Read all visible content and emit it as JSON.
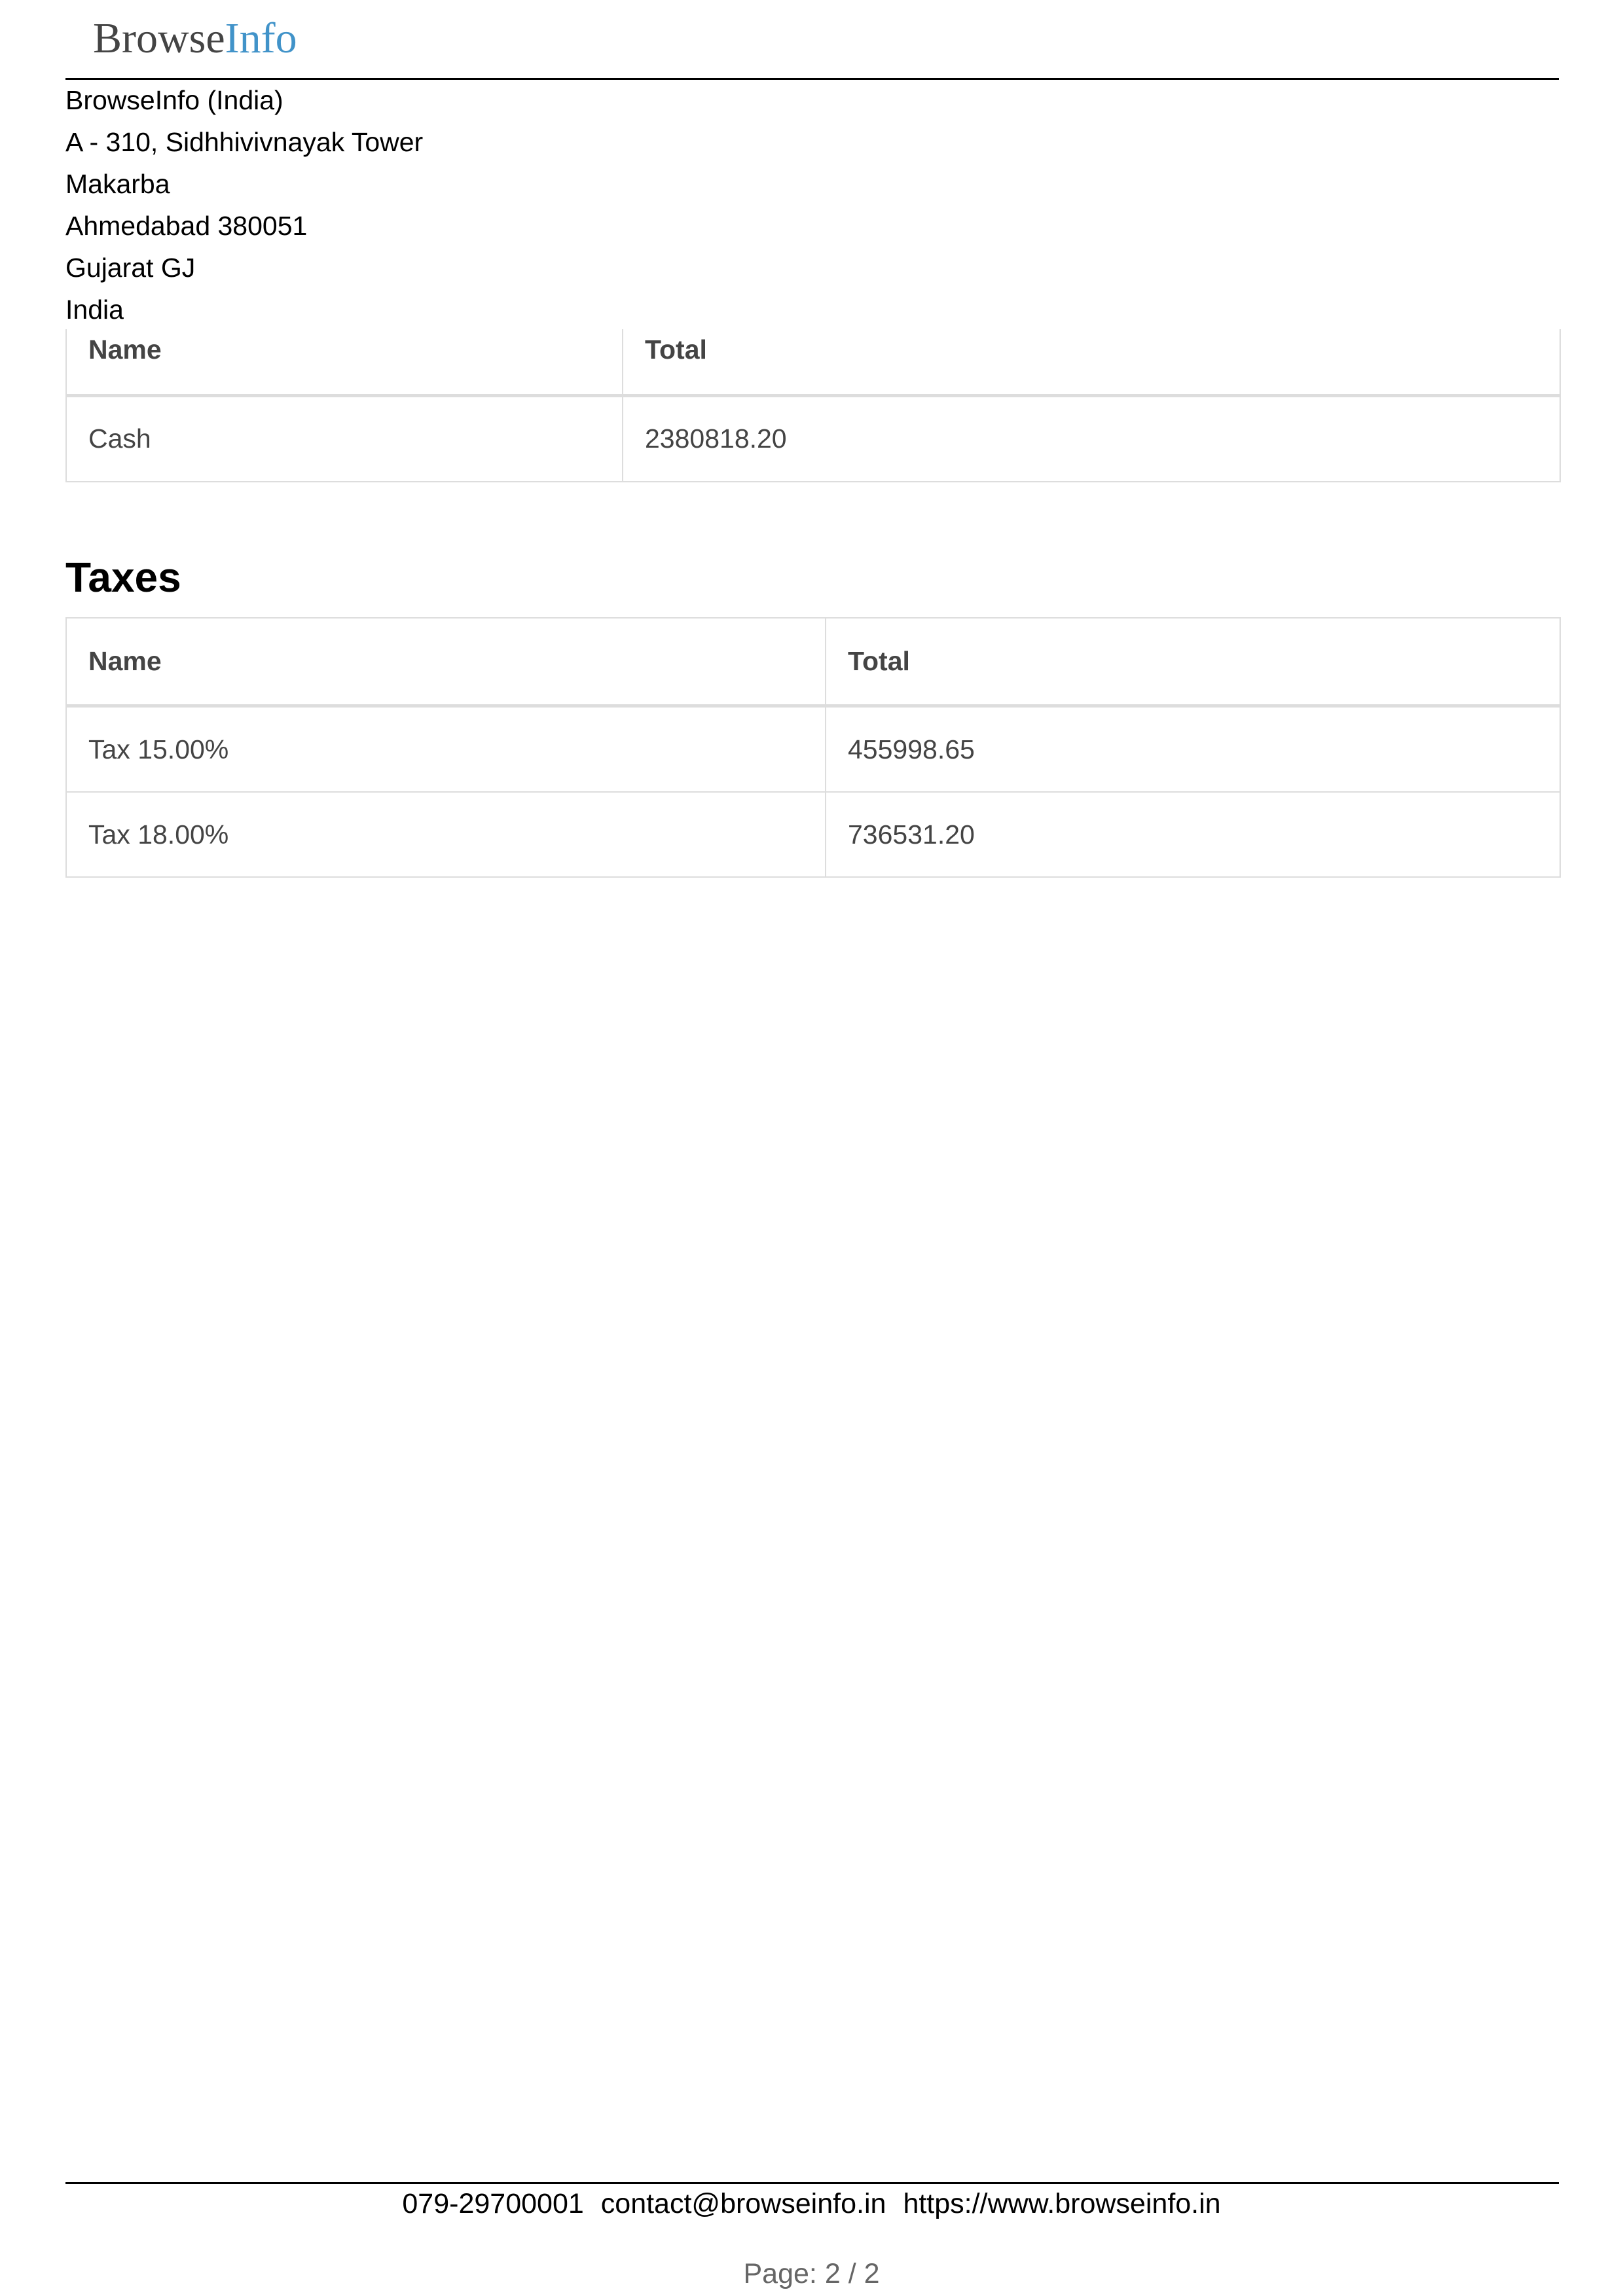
{
  "header": {
    "logo_part1": "Browse",
    "logo_part2": "Info",
    "logo_colors": {
      "part1": "#444444",
      "part2": "#4193c9"
    }
  },
  "company": {
    "name": "BrowseInfo (India)",
    "address_line1": "A - 310, Sidhhivivnayak Tower",
    "address_line2": "Makarba",
    "city_zip": "Ahmedabad 380051",
    "state": "Gujarat GJ",
    "country": "India"
  },
  "payments": {
    "columns": [
      "Name",
      "Total"
    ],
    "rows": [
      {
        "name": "Cash",
        "total": "2380818.20"
      }
    ]
  },
  "taxes": {
    "title": "Taxes",
    "columns": [
      "Name",
      "Total"
    ],
    "rows": [
      {
        "name": "Tax 15.00%",
        "total": "455998.65"
      },
      {
        "name": "Tax 18.00%",
        "total": "736531.20"
      }
    ]
  },
  "footer": {
    "phone": "079-29700001",
    "email": "contact@browseinfo.in",
    "website": "https://www.browseinfo.in",
    "page_label": "Page:",
    "page_current": "2",
    "page_separator": "/",
    "page_total": "2"
  }
}
